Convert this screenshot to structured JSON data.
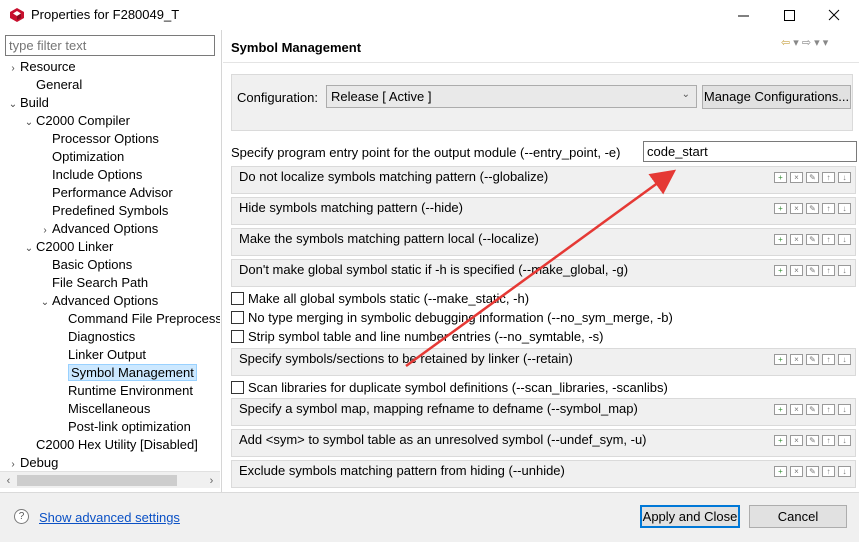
{
  "window": {
    "title": "Properties for F280049_T"
  },
  "filter": {
    "placeholder": "type filter text"
  },
  "tree": [
    {
      "label": "Resource",
      "indent": 0,
      "toggle": "›"
    },
    {
      "label": "General",
      "indent": 1,
      "toggle": ""
    },
    {
      "label": "Build",
      "indent": 0,
      "toggle": "⌄"
    },
    {
      "label": "C2000 Compiler",
      "indent": 1,
      "toggle": "⌄"
    },
    {
      "label": "Processor Options",
      "indent": 2,
      "toggle": ""
    },
    {
      "label": "Optimization",
      "indent": 2,
      "toggle": ""
    },
    {
      "label": "Include Options",
      "indent": 2,
      "toggle": ""
    },
    {
      "label": "Performance Advisor",
      "indent": 2,
      "toggle": ""
    },
    {
      "label": "Predefined Symbols",
      "indent": 2,
      "toggle": ""
    },
    {
      "label": "Advanced Options",
      "indent": 2,
      "toggle": "›"
    },
    {
      "label": "C2000 Linker",
      "indent": 1,
      "toggle": "⌄"
    },
    {
      "label": "Basic Options",
      "indent": 2,
      "toggle": ""
    },
    {
      "label": "File Search Path",
      "indent": 2,
      "toggle": ""
    },
    {
      "label": "Advanced Options",
      "indent": 2,
      "toggle": "⌄"
    },
    {
      "label": "Command File Preprocessing",
      "indent": 3,
      "toggle": ""
    },
    {
      "label": "Diagnostics",
      "indent": 3,
      "toggle": ""
    },
    {
      "label": "Linker Output",
      "indent": 3,
      "toggle": ""
    },
    {
      "label": "Symbol Management",
      "indent": 3,
      "toggle": "",
      "selected": true
    },
    {
      "label": "Runtime Environment",
      "indent": 3,
      "toggle": ""
    },
    {
      "label": "Miscellaneous",
      "indent": 3,
      "toggle": ""
    },
    {
      "label": "Post-link optimization",
      "indent": 3,
      "toggle": ""
    },
    {
      "label": "C2000 Hex Utility  [Disabled]",
      "indent": 1,
      "toggle": ""
    },
    {
      "label": "Debug",
      "indent": 0,
      "toggle": "›"
    }
  ],
  "page": {
    "title": "Symbol Management",
    "config_label": "Configuration:",
    "config_value": "Release  [ Active ]",
    "manage_label": "Manage Configurations...",
    "entry_label": "Specify program entry point for the output module (--entry_point, -e)",
    "entry_value": "code_start",
    "options": [
      {
        "kind": "list",
        "label": "Do not localize symbols matching pattern (--globalize)"
      },
      {
        "kind": "list",
        "label": "Hide symbols matching pattern (--hide)"
      },
      {
        "kind": "list",
        "label": "Make the symbols matching pattern local (--localize)"
      },
      {
        "kind": "list",
        "label": "Don't make global symbol static if -h is specified (--make_global, -g)"
      },
      {
        "kind": "check",
        "label": "Make all global symbols static (--make_static, -h)"
      },
      {
        "kind": "check",
        "label": "No type merging in symbolic debugging information (--no_sym_merge, -b)"
      },
      {
        "kind": "check",
        "label": "Strip symbol table and line number entries (--no_symtable, -s)"
      },
      {
        "kind": "list",
        "label": "Specify symbols/sections to be retained by linker (--retain)"
      },
      {
        "kind": "check",
        "label": "Scan libraries for duplicate symbol definitions (--scan_libraries, -scanlibs)"
      },
      {
        "kind": "list",
        "label": "Specify a symbol map, mapping refname to defname (--symbol_map)"
      },
      {
        "kind": "list",
        "label": "Add <sym> to symbol table as an unresolved symbol (--undef_sym, -u)"
      },
      {
        "kind": "list",
        "label": "Exclude symbols matching pattern from hiding (--unhide)"
      }
    ]
  },
  "footer": {
    "advanced_link": "Show advanced settings",
    "apply_label": "Apply and Close",
    "cancel_label": "Cancel"
  },
  "colors": {
    "accent": "#0078d7",
    "annotation_arrow": "#e53935",
    "link": "#0b51c5"
  }
}
